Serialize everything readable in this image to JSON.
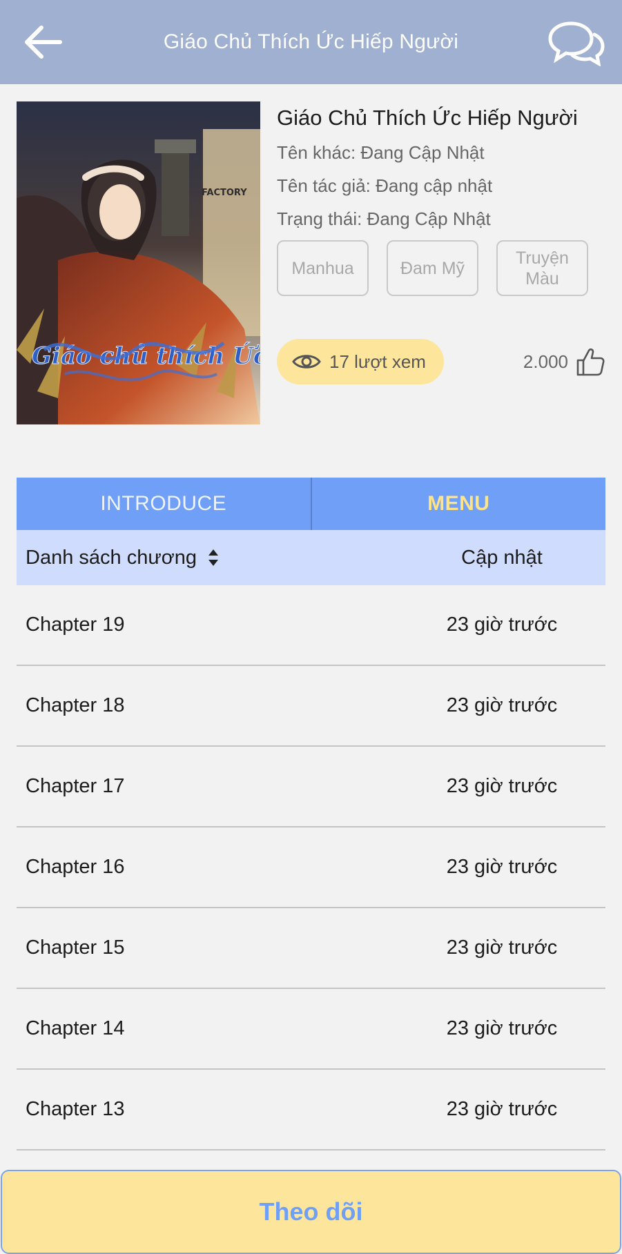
{
  "header": {
    "title": "Giáo Chủ Thích Ức Hiếp Người"
  },
  "book": {
    "title": "Giáo Chủ Thích Ức Hiếp Người",
    "alt_name": "Tên khác: Đang Cập Nhật",
    "author": "Tên tác giả: Đang cập nhật",
    "status": "Trạng thái: Đang Cập Nhật",
    "tags": [
      "Manhua",
      "Đam Mỹ",
      "Truyện Màu"
    ],
    "views": "17 lượt xem",
    "likes": "2.000",
    "cover_text": {
      "publisher": "FACTORY",
      "calligraphy": "Giáo chủ thích Ức hiếp người"
    }
  },
  "tabs": [
    {
      "label": "INTRODUCE",
      "active": false
    },
    {
      "label": "MENU",
      "active": true
    }
  ],
  "list_header": {
    "chapters_label": "Danh sách chương",
    "updated_label": "Cập nhật"
  },
  "chapters": [
    {
      "name": "Chapter 19",
      "time": "23 giờ trước"
    },
    {
      "name": "Chapter 18",
      "time": "23 giờ trước"
    },
    {
      "name": "Chapter 17",
      "time": "23 giờ trước"
    },
    {
      "name": "Chapter 16",
      "time": "23 giờ trước"
    },
    {
      "name": "Chapter 15",
      "time": "23 giờ trước"
    },
    {
      "name": "Chapter 14",
      "time": "23 giờ trước"
    },
    {
      "name": "Chapter 13",
      "time": "23 giờ trước"
    }
  ],
  "follow_button": "Theo dõi",
  "colors": {
    "app_bar": "#9fb0d1",
    "tab_bar": "#6f9ff7",
    "active_tab_text": "#fde38a",
    "list_header": "#cfdcfd",
    "views_pill": "#fde69c",
    "follow_bg": "#fde69c",
    "follow_text": "#6f9ff7"
  },
  "icons": {
    "back": "arrow-left-icon",
    "chat": "chat-bubbles-icon",
    "views": "eye-icon",
    "likes": "thumbs-up-icon",
    "sort": "sort-icon"
  }
}
